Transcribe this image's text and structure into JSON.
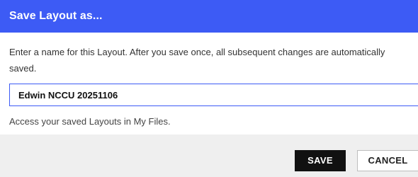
{
  "dialog": {
    "title": "Save Layout as...",
    "instructions": "Enter a name for this Layout. After you save once, all subsequent changes are automatically saved.",
    "name_input": {
      "value": "Edwin NCCU 20251106"
    },
    "hint": "Access your saved Layouts in My Files.",
    "buttons": {
      "save_label": "SAVE",
      "cancel_label": "CANCEL"
    }
  },
  "colors": {
    "title_bar": "#3d5bf5",
    "input_border": "#3d5bf5",
    "save_button": "#111111",
    "footer_background": "#efefef"
  }
}
